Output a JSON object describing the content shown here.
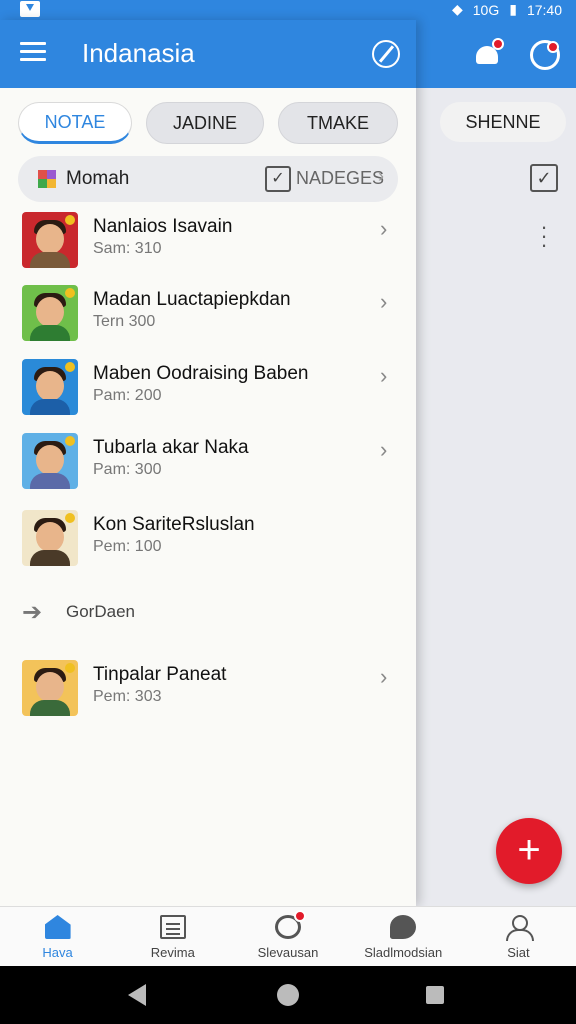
{
  "status_bar": {
    "network": "10G",
    "time": "17:40"
  },
  "app": {
    "title": "Indanasia"
  },
  "tabs": [
    {
      "label": "NOTAE",
      "active": true
    },
    {
      "label": "JADINE",
      "active": false
    },
    {
      "label": "TMAKE",
      "active": false
    }
  ],
  "background_tab": {
    "label": "SHENNE"
  },
  "filter": {
    "label": "Momah",
    "badge_label": "NADEGES"
  },
  "contacts": [
    {
      "name": "Nanlaios Isavain",
      "sub": "Sam: 310",
      "bg": "#c9282d",
      "shirt": "#7a5a3a"
    },
    {
      "name": "Madan Luactapiepkdan",
      "sub": "Tern 300",
      "bg": "#6fbf4a",
      "shirt": "#2e7d32"
    },
    {
      "name": "Maben Oodraising Baben",
      "sub": "Pam: 200",
      "bg": "#2a8ad8",
      "shirt": "#1c5fa8"
    },
    {
      "name": "Tubarla akar Naka",
      "sub": "Pam: 300",
      "bg": "#5fb0e6",
      "shirt": "#5b6aa8"
    },
    {
      "name": "Kon SariteRsluslan",
      "sub": "Pem: 100",
      "bg": "#f1e6c9",
      "shirt": "#4a3a28"
    }
  ],
  "section": {
    "label": "GorDaen"
  },
  "section_contacts": [
    {
      "name": "Tinpalar Paneat",
      "sub": "Pem: 303",
      "bg": "#f3c35a",
      "shirt": "#3a6a3a"
    }
  ],
  "fab": {
    "label": "+"
  },
  "bottom_nav": [
    {
      "label": "Hava",
      "icon": "home-icon",
      "active": true
    },
    {
      "label": "Revima",
      "icon": "reviews-icon",
      "active": false
    },
    {
      "label": "Slevausan",
      "icon": "trend-icon",
      "active": false
    },
    {
      "label": "Sladlmodsian",
      "icon": "social-icon",
      "active": false
    },
    {
      "label": "Siat",
      "icon": "profile-icon",
      "active": false
    }
  ],
  "colors": {
    "primary": "#2f86df",
    "accent": "#e21b2a"
  }
}
